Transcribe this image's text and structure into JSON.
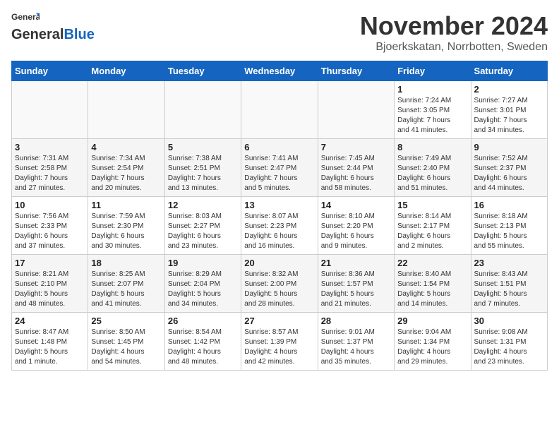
{
  "header": {
    "logo_general": "General",
    "logo_blue": "Blue",
    "month_title": "November 2024",
    "subtitle": "Bjoerkskatan, Norrbotten, Sweden"
  },
  "calendar": {
    "weekdays": [
      "Sunday",
      "Monday",
      "Tuesday",
      "Wednesday",
      "Thursday",
      "Friday",
      "Saturday"
    ],
    "weeks": [
      [
        {
          "day": "",
          "info": ""
        },
        {
          "day": "",
          "info": ""
        },
        {
          "day": "",
          "info": ""
        },
        {
          "day": "",
          "info": ""
        },
        {
          "day": "",
          "info": ""
        },
        {
          "day": "1",
          "info": "Sunrise: 7:24 AM\nSunset: 3:05 PM\nDaylight: 7 hours\nand 41 minutes."
        },
        {
          "day": "2",
          "info": "Sunrise: 7:27 AM\nSunset: 3:01 PM\nDaylight: 7 hours\nand 34 minutes."
        }
      ],
      [
        {
          "day": "3",
          "info": "Sunrise: 7:31 AM\nSunset: 2:58 PM\nDaylight: 7 hours\nand 27 minutes."
        },
        {
          "day": "4",
          "info": "Sunrise: 7:34 AM\nSunset: 2:54 PM\nDaylight: 7 hours\nand 20 minutes."
        },
        {
          "day": "5",
          "info": "Sunrise: 7:38 AM\nSunset: 2:51 PM\nDaylight: 7 hours\nand 13 minutes."
        },
        {
          "day": "6",
          "info": "Sunrise: 7:41 AM\nSunset: 2:47 PM\nDaylight: 7 hours\nand 5 minutes."
        },
        {
          "day": "7",
          "info": "Sunrise: 7:45 AM\nSunset: 2:44 PM\nDaylight: 6 hours\nand 58 minutes."
        },
        {
          "day": "8",
          "info": "Sunrise: 7:49 AM\nSunset: 2:40 PM\nDaylight: 6 hours\nand 51 minutes."
        },
        {
          "day": "9",
          "info": "Sunrise: 7:52 AM\nSunset: 2:37 PM\nDaylight: 6 hours\nand 44 minutes."
        }
      ],
      [
        {
          "day": "10",
          "info": "Sunrise: 7:56 AM\nSunset: 2:33 PM\nDaylight: 6 hours\nand 37 minutes."
        },
        {
          "day": "11",
          "info": "Sunrise: 7:59 AM\nSunset: 2:30 PM\nDaylight: 6 hours\nand 30 minutes."
        },
        {
          "day": "12",
          "info": "Sunrise: 8:03 AM\nSunset: 2:27 PM\nDaylight: 6 hours\nand 23 minutes."
        },
        {
          "day": "13",
          "info": "Sunrise: 8:07 AM\nSunset: 2:23 PM\nDaylight: 6 hours\nand 16 minutes."
        },
        {
          "day": "14",
          "info": "Sunrise: 8:10 AM\nSunset: 2:20 PM\nDaylight: 6 hours\nand 9 minutes."
        },
        {
          "day": "15",
          "info": "Sunrise: 8:14 AM\nSunset: 2:17 PM\nDaylight: 6 hours\nand 2 minutes."
        },
        {
          "day": "16",
          "info": "Sunrise: 8:18 AM\nSunset: 2:13 PM\nDaylight: 5 hours\nand 55 minutes."
        }
      ],
      [
        {
          "day": "17",
          "info": "Sunrise: 8:21 AM\nSunset: 2:10 PM\nDaylight: 5 hours\nand 48 minutes."
        },
        {
          "day": "18",
          "info": "Sunrise: 8:25 AM\nSunset: 2:07 PM\nDaylight: 5 hours\nand 41 minutes."
        },
        {
          "day": "19",
          "info": "Sunrise: 8:29 AM\nSunset: 2:04 PM\nDaylight: 5 hours\nand 34 minutes."
        },
        {
          "day": "20",
          "info": "Sunrise: 8:32 AM\nSunset: 2:00 PM\nDaylight: 5 hours\nand 28 minutes."
        },
        {
          "day": "21",
          "info": "Sunrise: 8:36 AM\nSunset: 1:57 PM\nDaylight: 5 hours\nand 21 minutes."
        },
        {
          "day": "22",
          "info": "Sunrise: 8:40 AM\nSunset: 1:54 PM\nDaylight: 5 hours\nand 14 minutes."
        },
        {
          "day": "23",
          "info": "Sunrise: 8:43 AM\nSunset: 1:51 PM\nDaylight: 5 hours\nand 7 minutes."
        }
      ],
      [
        {
          "day": "24",
          "info": "Sunrise: 8:47 AM\nSunset: 1:48 PM\nDaylight: 5 hours\nand 1 minute."
        },
        {
          "day": "25",
          "info": "Sunrise: 8:50 AM\nSunset: 1:45 PM\nDaylight: 4 hours\nand 54 minutes."
        },
        {
          "day": "26",
          "info": "Sunrise: 8:54 AM\nSunset: 1:42 PM\nDaylight: 4 hours\nand 48 minutes."
        },
        {
          "day": "27",
          "info": "Sunrise: 8:57 AM\nSunset: 1:39 PM\nDaylight: 4 hours\nand 42 minutes."
        },
        {
          "day": "28",
          "info": "Sunrise: 9:01 AM\nSunset: 1:37 PM\nDaylight: 4 hours\nand 35 minutes."
        },
        {
          "day": "29",
          "info": "Sunrise: 9:04 AM\nSunset: 1:34 PM\nDaylight: 4 hours\nand 29 minutes."
        },
        {
          "day": "30",
          "info": "Sunrise: 9:08 AM\nSunset: 1:31 PM\nDaylight: 4 hours\nand 23 minutes."
        }
      ]
    ]
  }
}
